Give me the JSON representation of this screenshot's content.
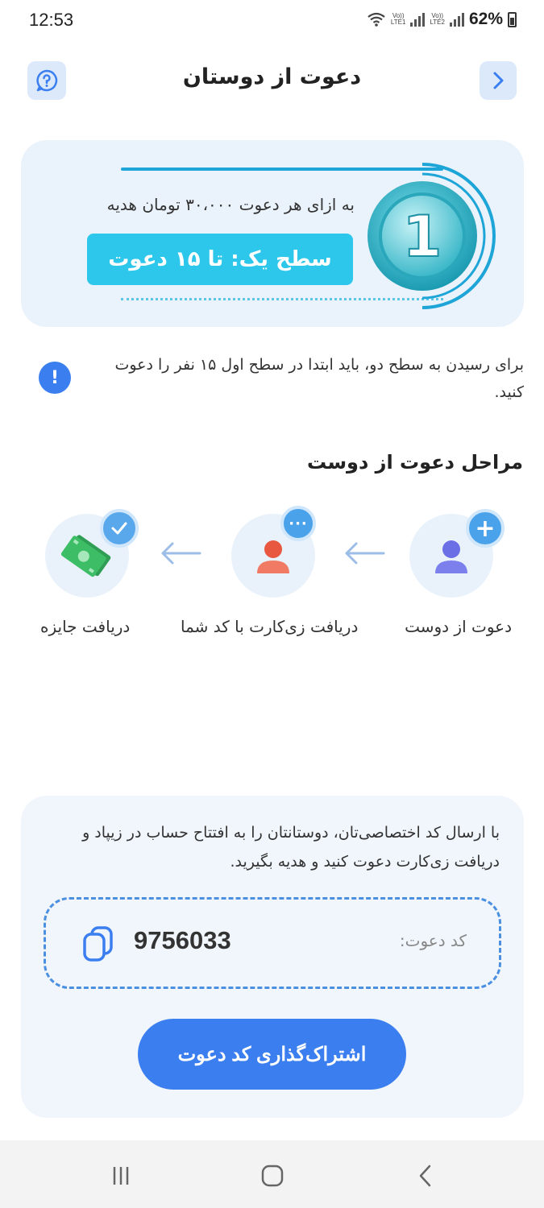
{
  "status_bar": {
    "time": "12:53",
    "battery": "62%",
    "sim1": "LTE1",
    "sim2": "LTE2",
    "volte": "Vo))"
  },
  "header": {
    "title": "دعوت از دوستان"
  },
  "level": {
    "gift_text": "به ازای هر دعوت ۳۰،۰۰۰ تومان هدیه",
    "pill_text": "سطح یک: تا ۱۵ دعوت",
    "badge_number": "1"
  },
  "note": {
    "text": "برای رسیدن به سطح دو، باید ابتدا در سطح اول ۱۵ نفر را دعوت کنید."
  },
  "steps": {
    "title": "مراحل دعوت از دوست",
    "items": [
      {
        "label": "دعوت از دوست",
        "icon": "user-plus-icon"
      },
      {
        "label": "دریافت زی‌کارت با کد شما",
        "icon": "user-chat-icon"
      },
      {
        "label": "دریافت جایزه",
        "icon": "cash-check-icon"
      }
    ]
  },
  "invite": {
    "description": "با ارسال کد اختصاصی‌تان، دوستانتان را به افتتاح حساب در زیپاد و دریافت زی‌کارت دعوت کنید و هدیه بگیرید.",
    "code_label": "کد دعوت:",
    "code_value": "9756033",
    "share_label": "اشتراک‌گذاری کد دعوت"
  },
  "colors": {
    "primary": "#3b7ef0",
    "accent_cyan": "#2cc7ea",
    "card_bg": "#eaf3fc"
  }
}
